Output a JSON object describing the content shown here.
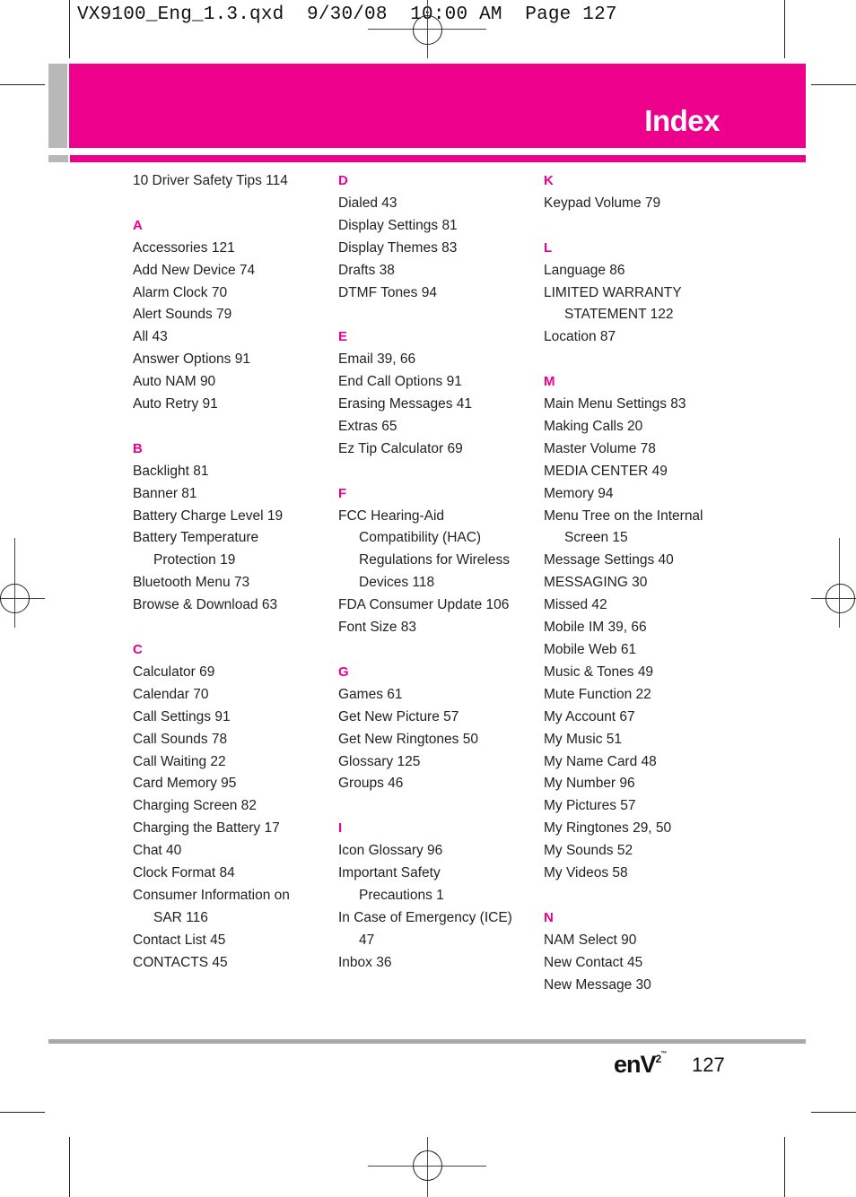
{
  "slug_line": "VX9100_Eng_1.3.qxd  9/30/08  10:00 AM  Page 127",
  "header": {
    "title": "Index",
    "accent_color": "#ec008c",
    "gray_color": "#b8b8b8"
  },
  "columns": [
    {
      "groups": [
        {
          "letter": "",
          "entries": [
            {
              "text": "10 Driver Safety Tips 114"
            }
          ]
        },
        {
          "letter": "A",
          "entries": [
            {
              "text": "Accessories 121"
            },
            {
              "text": "Add New Device 74"
            },
            {
              "text": "Alarm Clock 70"
            },
            {
              "text": "Alert Sounds 79"
            },
            {
              "text": "All 43"
            },
            {
              "text": "Answer Options 91"
            },
            {
              "text": "Auto NAM 90"
            },
            {
              "text": "Auto Retry 91"
            }
          ]
        },
        {
          "letter": "B",
          "entries": [
            {
              "text": "Backlight 81"
            },
            {
              "text": "Banner 81"
            },
            {
              "text": "Battery Charge Level 19"
            },
            {
              "text": "Battery Temperature"
            },
            {
              "text": "Protection 19",
              "cont": true
            },
            {
              "text": "Bluetooth Menu 73"
            },
            {
              "text": "Browse & Download 63"
            }
          ]
        },
        {
          "letter": "C",
          "entries": [
            {
              "text": "Calculator 69"
            },
            {
              "text": "Calendar 70"
            },
            {
              "text": "Call Settings 91"
            },
            {
              "text": "Call Sounds 78"
            },
            {
              "text": "Call Waiting 22"
            },
            {
              "text": "Card Memory 95"
            },
            {
              "text": "Charging Screen 82"
            },
            {
              "text": "Charging the Battery 17"
            },
            {
              "text": "Chat 40"
            },
            {
              "text": "Clock Format 84"
            },
            {
              "text": "Consumer Information on"
            },
            {
              "text": "SAR 116",
              "cont": true
            },
            {
              "text": "Contact List 45"
            },
            {
              "text": "CONTACTS 45"
            }
          ]
        }
      ]
    },
    {
      "groups": [
        {
          "letter": "D",
          "entries": [
            {
              "text": "Dialed 43"
            },
            {
              "text": "Display Settings 81"
            },
            {
              "text": "Display Themes 83"
            },
            {
              "text": "Drafts 38"
            },
            {
              "text": "DTMF Tones 94"
            }
          ]
        },
        {
          "letter": "E",
          "entries": [
            {
              "text": "Email 39, 66"
            },
            {
              "text": "End Call Options 91"
            },
            {
              "text": "Erasing Messages 41"
            },
            {
              "text": "Extras 65"
            },
            {
              "text": "Ez Tip Calculator 69"
            }
          ]
        },
        {
          "letter": "F",
          "entries": [
            {
              "text": "FCC Hearing-Aid"
            },
            {
              "text": "Compatibility (HAC)",
              "cont": true
            },
            {
              "text": "Regulations for Wireless",
              "cont": true
            },
            {
              "text": "Devices 118",
              "cont": true
            },
            {
              "text": "FDA Consumer Update 106"
            },
            {
              "text": "Font Size 83"
            }
          ]
        },
        {
          "letter": "G",
          "entries": [
            {
              "text": "Games 61"
            },
            {
              "text": "Get New Picture 57"
            },
            {
              "text": "Get New Ringtones 50"
            },
            {
              "text": "Glossary 125"
            },
            {
              "text": "Groups 46"
            }
          ]
        },
        {
          "letter": "I",
          "entries": [
            {
              "text": "Icon Glossary 96"
            },
            {
              "text": "Important Safety"
            },
            {
              "text": "Precautions 1",
              "cont": true
            },
            {
              "text": "In Case of Emergency (ICE)"
            },
            {
              "text": "47",
              "cont": true
            },
            {
              "text": "Inbox 36"
            }
          ]
        }
      ]
    },
    {
      "groups": [
        {
          "letter": "K",
          "entries": [
            {
              "text": "Keypad Volume 79"
            }
          ]
        },
        {
          "letter": "L",
          "entries": [
            {
              "text": "Language 86"
            },
            {
              "text": "LIMITED WARRANTY"
            },
            {
              "text": "STATEMENT 122",
              "cont": true
            },
            {
              "text": "Location 87"
            }
          ]
        },
        {
          "letter": "M",
          "entries": [
            {
              "text": "Main Menu Settings 83"
            },
            {
              "text": "Making Calls 20"
            },
            {
              "text": "Master Volume 78"
            },
            {
              "text": "MEDIA CENTER 49"
            },
            {
              "text": "Memory 94"
            },
            {
              "text": "Menu Tree on the Internal"
            },
            {
              "text": "Screen 15",
              "cont": true
            },
            {
              "text": "Message Settings 40"
            },
            {
              "text": "MESSAGING 30"
            },
            {
              "text": "Missed 42"
            },
            {
              "text": "Mobile IM 39, 66"
            },
            {
              "text": "Mobile Web 61"
            },
            {
              "text": "Music & Tones 49"
            },
            {
              "text": "Mute Function 22"
            },
            {
              "text": "My Account 67"
            },
            {
              "text": "My Music 51"
            },
            {
              "text": "My Name Card 48"
            },
            {
              "text": "My Number 96"
            },
            {
              "text": "My Pictures 57"
            },
            {
              "text": "My Ringtones 29, 50"
            },
            {
              "text": "My Sounds 52"
            },
            {
              "text": "My Videos 58"
            }
          ]
        },
        {
          "letter": "N",
          "entries": [
            {
              "text": "NAM Select 90"
            },
            {
              "text": "New Contact 45"
            },
            {
              "text": "New Message 30"
            }
          ]
        }
      ]
    }
  ],
  "footer": {
    "brand": "enV",
    "brand_sup": "2",
    "brand_tm": "™",
    "page_number": "127"
  }
}
